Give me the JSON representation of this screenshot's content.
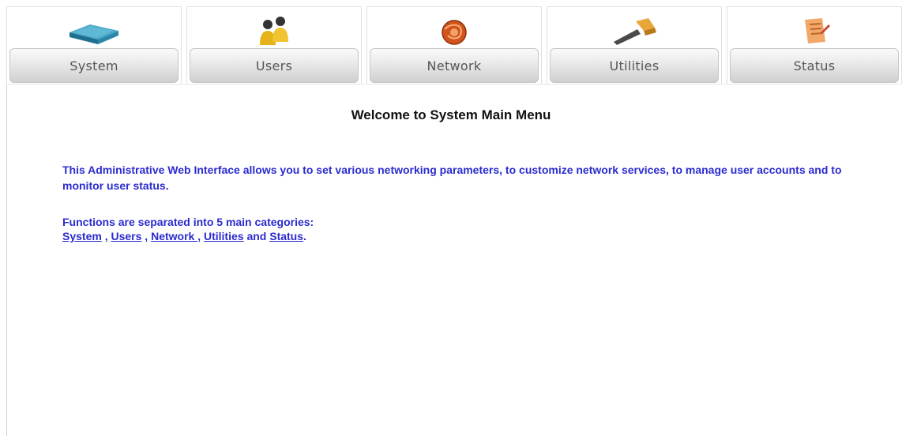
{
  "tabs": [
    {
      "label": "System",
      "icon": "server-icon"
    },
    {
      "label": "Users",
      "icon": "users-icon"
    },
    {
      "label": "Network",
      "icon": "globe-icon"
    },
    {
      "label": "Utilities",
      "icon": "hammer-icon"
    },
    {
      "label": "Status",
      "icon": "document-icon"
    }
  ],
  "main": {
    "title": "Welcome to System Main Menu",
    "intro": "This Administrative Web Interface allows you to set various networking parameters, to customize network services, to manage user accounts and to monitor user status.",
    "categories_heading": "Functions are separated into 5 main categories:",
    "links": {
      "system": "System",
      "users": "Users",
      "network": "Network ",
      "utilities": "Utilities",
      "status": "Status"
    },
    "sep_comma": " , ",
    "sep_and": " and ",
    "period": "."
  },
  "colors": {
    "text_blue": "#2b2bd0",
    "tab_gray": "#e9e9e9"
  }
}
